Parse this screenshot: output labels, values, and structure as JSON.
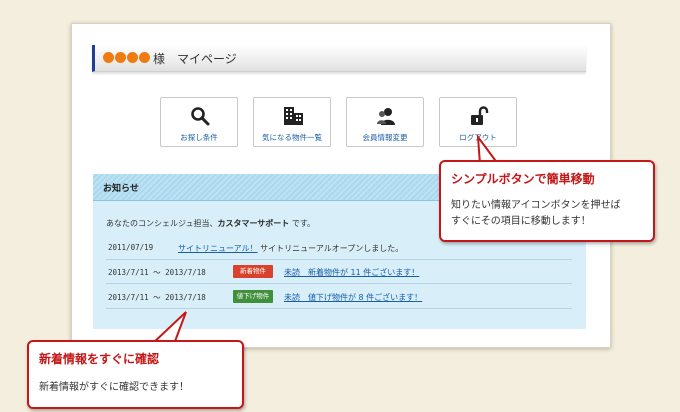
{
  "header": {
    "title": "様　マイページ"
  },
  "nav_buttons": [
    {
      "label": "お探し条件",
      "icon": "search-icon"
    },
    {
      "label": "気になる物件一覧",
      "icon": "building-icon"
    },
    {
      "label": "会員情報変更",
      "icon": "user-icon"
    },
    {
      "label": "ログアウト",
      "icon": "unlock-icon"
    }
  ],
  "news": {
    "title": "お知らせ",
    "intro_prefix": "あなたのコンシェルジュ担当、",
    "intro_name": "カスタマーサポート",
    "intro_suffix": "です。",
    "rows": [
      {
        "date": "2011/07/19",
        "link": "サイトリニューアル！",
        "text": "サイトリニューアルオープンしました。"
      },
      {
        "date": "2013/7/11 ～ 2013/7/18",
        "badge": "新着物件",
        "link": "未読　新着物件が 11 件ございます！"
      },
      {
        "date": "2013/7/11 ～ 2013/7/18",
        "badge": "値下げ物件",
        "link": "未読　値下げ物件が 8 件ございます！"
      }
    ]
  },
  "callout_right": {
    "title": "シンプルボタンで簡単移動",
    "body_1": "知りたい情報アイコンボタンを押せば",
    "body_2": "すぐにその項目に移動します！"
  },
  "callout_left": {
    "title": "新着情報をすぐに確認",
    "body": "新着情報がすぐに確認できます！"
  },
  "colors": {
    "accent": "#f07b10",
    "callout": "#c41818",
    "badge_new": "#d8412b",
    "badge_discount": "#3f8f3b",
    "link": "#1a5da8"
  }
}
